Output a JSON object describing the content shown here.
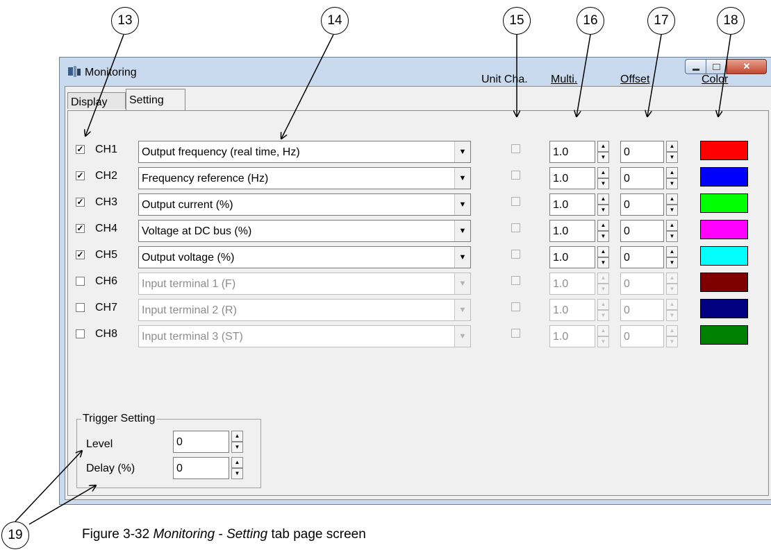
{
  "window": {
    "title": "Monitoring"
  },
  "tabs": [
    "Display",
    "Setting"
  ],
  "headers": {
    "unit": "Unit Cha.",
    "multi": "Multi.",
    "offset": "Offset",
    "color": "Color"
  },
  "channels": [
    {
      "label": "CH1",
      "checked": true,
      "signal": "Output frequency (real time, Hz)",
      "multi": "1.0",
      "offset": "0",
      "color": "#ff0000"
    },
    {
      "label": "CH2",
      "checked": true,
      "signal": "Frequency reference (Hz)",
      "multi": "1.0",
      "offset": "0",
      "color": "#0000ff"
    },
    {
      "label": "CH3",
      "checked": true,
      "signal": "Output current (%)",
      "multi": "1.0",
      "offset": "0",
      "color": "#00ff00"
    },
    {
      "label": "CH4",
      "checked": true,
      "signal": "Voltage at DC bus (%)",
      "multi": "1.0",
      "offset": "0",
      "color": "#ff00ff"
    },
    {
      "label": "CH5",
      "checked": true,
      "signal": "Output voltage (%)",
      "multi": "1.0",
      "offset": "0",
      "color": "#00ffff"
    },
    {
      "label": "CH6",
      "checked": false,
      "signal": "Input terminal 1 (F)",
      "multi": "1.0",
      "offset": "0",
      "color": "#800000"
    },
    {
      "label": "CH7",
      "checked": false,
      "signal": "Input terminal 2 (R)",
      "multi": "1.0",
      "offset": "0",
      "color": "#000080"
    },
    {
      "label": "CH8",
      "checked": false,
      "signal": "Input terminal 3 (ST)",
      "multi": "1.0",
      "offset": "0",
      "color": "#008000"
    }
  ],
  "trigger": {
    "title": "Trigger Setting",
    "level_label": "Level",
    "level_value": "0",
    "delay_label": "Delay (%)",
    "delay_value": "0"
  },
  "callouts": [
    "13",
    "14",
    "15",
    "16",
    "17",
    "18",
    "19"
  ],
  "caption": {
    "prefix": "Figure 3-32 ",
    "italic1": "Monitoring",
    "middle": " - ",
    "italic2": "Setting",
    "suffix": " tab page screen"
  }
}
